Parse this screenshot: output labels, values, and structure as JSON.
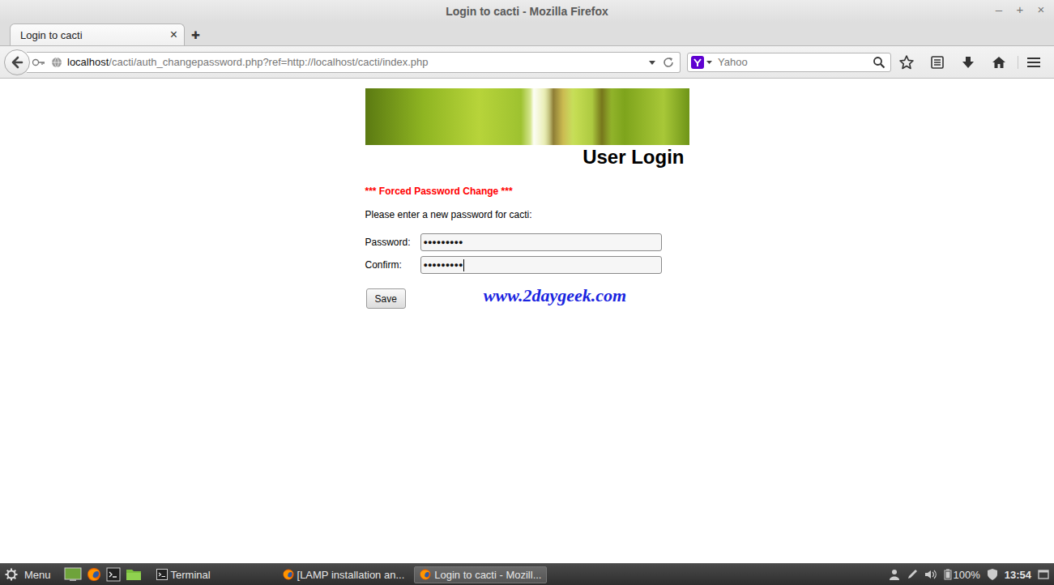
{
  "window": {
    "title": "Login to cacti - Mozilla Firefox",
    "controls": [
      "–",
      "+",
      "×"
    ]
  },
  "tabs": [
    {
      "label": "Login to cacti",
      "selected": true,
      "close": "×"
    }
  ],
  "new_tab": "✚",
  "address_bar": {
    "host": "localhost",
    "path": "/cacti/auth_changepassword.php?ref=http://localhost/cacti/index.php"
  },
  "search": {
    "placeholder": "Yahoo"
  },
  "page": {
    "heading": "User Login",
    "notice": "*** Forced Password Change ***",
    "prompt": "Please enter a new password for cacti:",
    "fields": [
      {
        "label": "Password:",
        "value": "●●●●●●●●●",
        "focused": false
      },
      {
        "label": "Confirm:",
        "value": "●●●●●●●●●",
        "focused": true
      }
    ],
    "save_button": "Save",
    "watermark": "www.2daygeek.com"
  },
  "taskbar": {
    "menu": "Menu",
    "windows": [
      {
        "label": "Terminal",
        "kind": "terminal",
        "selected": false
      },
      {
        "label": "[LAMP installation an...",
        "kind": "firefox",
        "selected": false
      },
      {
        "label": "Login to cacti - Mozill...",
        "kind": "firefox",
        "selected": true
      }
    ],
    "battery": "100%",
    "clock": "13:54"
  }
}
